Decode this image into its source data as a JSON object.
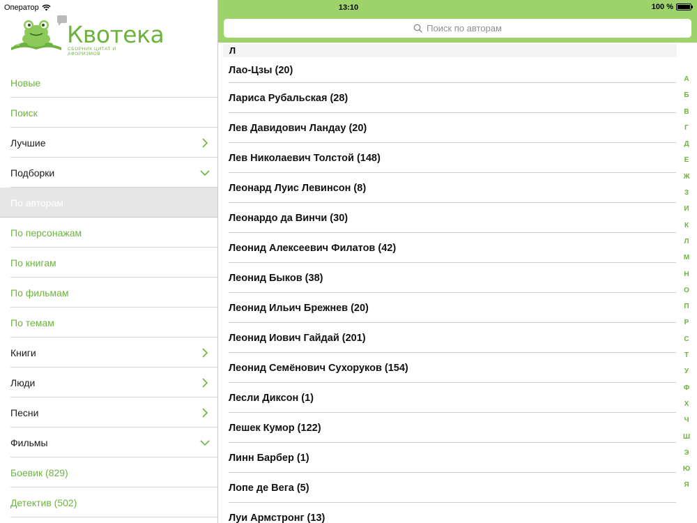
{
  "status": {
    "carrier": "Оператор",
    "time": "13:10",
    "battery": "100 %"
  },
  "logo": {
    "title": "Квотека",
    "subtitle": "сборник цитат и афоризмов"
  },
  "menu": [
    {
      "label": "Новые",
      "style": "green",
      "chevron": "none"
    },
    {
      "label": "Поиск",
      "style": "green",
      "chevron": "none"
    },
    {
      "label": "Лучшие",
      "style": "normal",
      "chevron": "chevron-right-icon"
    },
    {
      "label": "Подборки",
      "style": "normal",
      "chevron": "chevron-down-icon"
    },
    {
      "label": "По авторам",
      "style": "selected",
      "chevron": "none"
    },
    {
      "label": "По персонажам",
      "style": "green",
      "chevron": "none"
    },
    {
      "label": "По книгам",
      "style": "green",
      "chevron": "none"
    },
    {
      "label": "По фильмам",
      "style": "green",
      "chevron": "none"
    },
    {
      "label": "По темам",
      "style": "green",
      "chevron": "none"
    },
    {
      "label": "Книги",
      "style": "normal",
      "chevron": "chevron-right-icon"
    },
    {
      "label": "Люди",
      "style": "normal",
      "chevron": "chevron-right-icon"
    },
    {
      "label": "Песни",
      "style": "normal",
      "chevron": "chevron-right-icon"
    },
    {
      "label": "Фильмы",
      "style": "normal",
      "chevron": "chevron-down-icon"
    },
    {
      "label": "Боевик (829)",
      "style": "green",
      "chevron": "none"
    },
    {
      "label": "Детектив (502)",
      "style": "green",
      "chevron": "none"
    }
  ],
  "search": {
    "placeholder": "Поиск по авторам"
  },
  "section": {
    "letter": "Л"
  },
  "authors": [
    "Лао-Цзы (20)",
    "Лариса Рубальская (28)",
    "Лев Давидович Ландау (20)",
    "Лев Николаевич Толстой (148)",
    "Леонард Луис Левинсон (8)",
    "Леонардо да Винчи (30)",
    "Леонид Алексеевич Филатов (42)",
    "Леонид Быков (38)",
    "Леонид Ильич Брежнев (20)",
    "Леонид Иович Гайдай (201)",
    "Леонид Семёнович Сухоруков (154)",
    "Лесли Диксон (1)",
    "Лешек Кумор (122)",
    "Линн Барбер (1)",
    "Лопе де Вега (5)",
    "Луи Армстронг (13)"
  ],
  "index_letters": [
    "А",
    "Б",
    "В",
    "Г",
    "Д",
    "Е",
    "Ж",
    "З",
    "И",
    "К",
    "Л",
    "М",
    "Н",
    "О",
    "П",
    "Р",
    "С",
    "Т",
    "У",
    "Ф",
    "Х",
    "Ч",
    "Ш",
    "Э",
    "Ю",
    "Я"
  ],
  "colors": {
    "accent": "#6cb33e",
    "topbar": "#9ed26a",
    "selected_bg": "#e6e6e6"
  }
}
